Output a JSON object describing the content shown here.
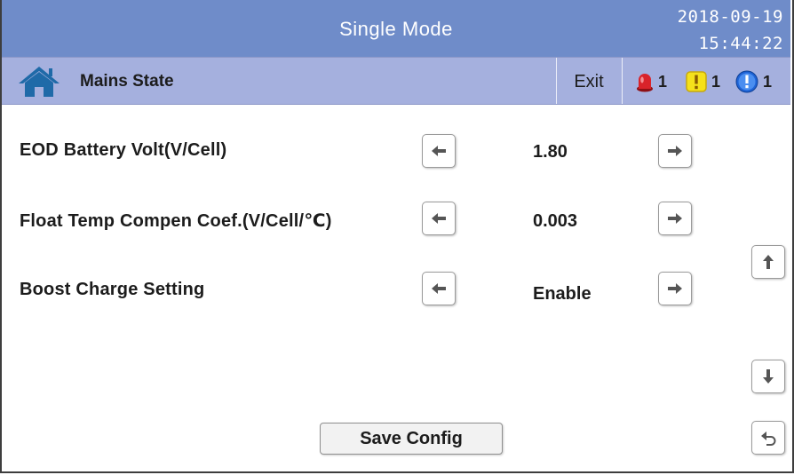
{
  "header": {
    "title": "Single Mode",
    "date": "2018-09-19",
    "time": "15:44:22"
  },
  "subbar": {
    "home_icon": "home-icon",
    "state_label": "Mains State",
    "exit_label": "Exit",
    "alarms": [
      {
        "icon": "critical-alarm-icon",
        "count": "1",
        "color": "#d9232a"
      },
      {
        "icon": "warning-alarm-icon",
        "count": "1",
        "color": "#f5e11b"
      },
      {
        "icon": "info-alarm-icon",
        "count": "1",
        "color": "#1e63d6"
      }
    ]
  },
  "settings": [
    {
      "label": "EOD Battery Volt(V/Cell)",
      "value": "1.80"
    },
    {
      "label": "Float Temp Compen Coef.(V/Cell/℃)",
      "value": "0.003"
    },
    {
      "label": "Boost Charge Setting",
      "value": "Enable"
    }
  ],
  "actions": {
    "save_label": "Save Config",
    "scroll_up_icon": "arrow-up-icon",
    "scroll_down_icon": "arrow-down-icon",
    "back_icon": "return-icon"
  },
  "colors": {
    "titlebar": "#6f8cc9",
    "subbar": "#a5b0de",
    "home_icon": "#1f6aa8"
  }
}
